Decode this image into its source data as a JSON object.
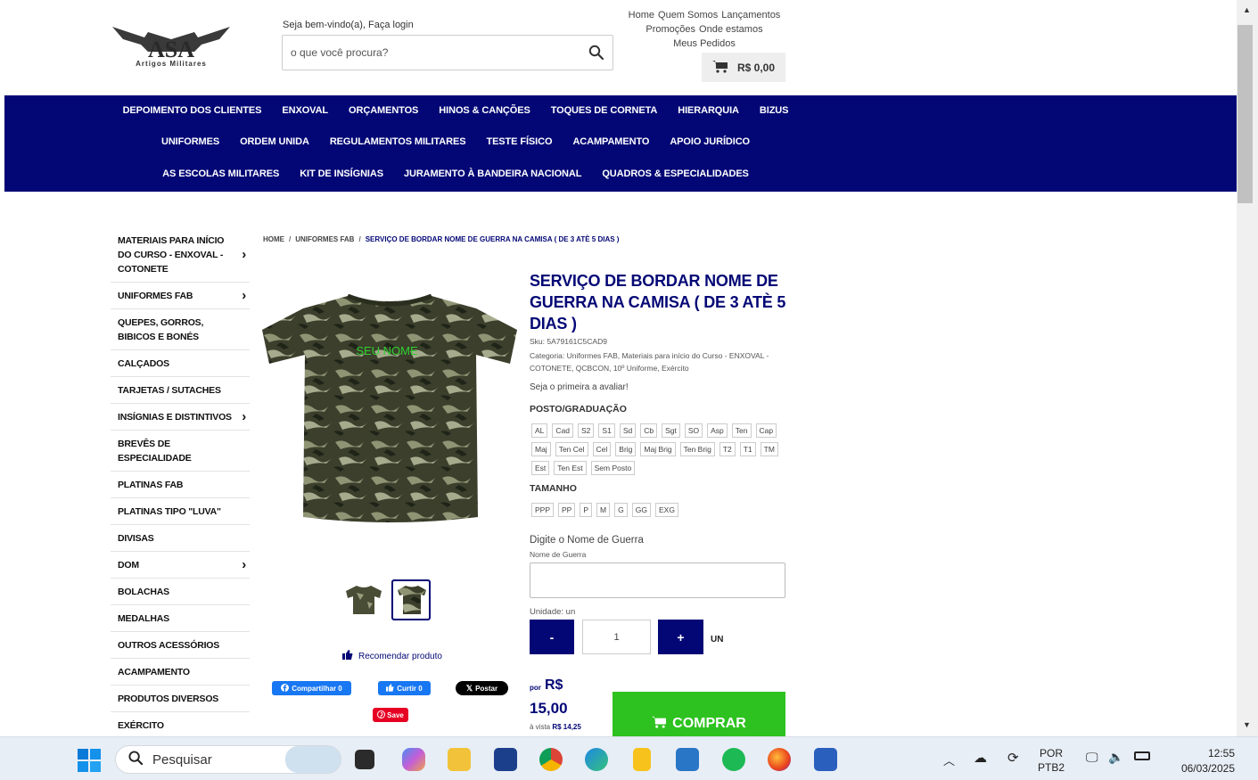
{
  "header": {
    "logo_text": "ASA",
    "logo_sub": "Artigos Militares",
    "welcome": "Seja bem-vindo(a), Faça login",
    "search_placeholder": "o que você procura?",
    "toplinks_row1": [
      "Home",
      "Quem Somos",
      "Lançamentos"
    ],
    "toplinks_row2": [
      "Promoções",
      "Onde estamos"
    ],
    "toplinks_row3": [
      "Meus Pedidos"
    ],
    "cart_total": "R$ 0,00"
  },
  "nav": {
    "row1": [
      "DEPOIMENTO DOS CLIENTES",
      "ENXOVAL",
      "ORÇAMENTOS",
      "HINOS & CANÇÕES",
      "TOQUES DE CORNETA",
      "HIERARQUIA",
      "BIZUS"
    ],
    "row2": [
      "UNIFORMES",
      "ORDEM UNIDA",
      "REGULAMENTOS MILITARES",
      "TESTE FÍSICO",
      "ACAMPAMENTO",
      "APOIO JURÍDICO"
    ],
    "row3": [
      "AS ESCOLAS MILITARES",
      "KIT DE INSÍGNIAS",
      "JURAMENTO À BANDEIRA NACIONAL",
      "QUADROS & ESPECIALIDADES"
    ]
  },
  "sidebar": {
    "items": [
      {
        "label": "MATERIAIS PARA INÍCIO DO CURSO - ENXOVAL - COTONETE",
        "chevron": true
      },
      {
        "label": "UNIFORMES FAB",
        "chevron": true
      },
      {
        "label": "QUEPES, GORROS, BIBICOS E BONÉS",
        "chevron": false
      },
      {
        "label": "CALÇADOS",
        "chevron": false
      },
      {
        "label": "TARJETAS / SUTACHES",
        "chevron": false
      },
      {
        "label": "INSÍGNIAS E DISTINTIVOS",
        "chevron": true
      },
      {
        "label": "BREVÊS DE ESPECIALIDADE",
        "chevron": false
      },
      {
        "label": "PLATINAS FAB",
        "chevron": false
      },
      {
        "label": "PLATINAS TIPO \"LUVA\"",
        "chevron": false
      },
      {
        "label": "DIVISAS",
        "chevron": false
      },
      {
        "label": "DOM",
        "chevron": true
      },
      {
        "label": "BOLACHAS",
        "chevron": false
      },
      {
        "label": "MEDALHAS",
        "chevron": false
      },
      {
        "label": "OUTROS ACESSÓRIOS",
        "chevron": false
      },
      {
        "label": "ACAMPAMENTO",
        "chevron": false
      },
      {
        "label": "PRODUTOS DIVERSOS",
        "chevron": false
      },
      {
        "label": "EXÉRCITO",
        "chevron": false
      }
    ]
  },
  "breadcrumb": {
    "home": "HOME",
    "category": "UNIFORMES FAB",
    "current": "SERVIÇO DE BORDAR NOME DE GUERRA NA CAMISA ( DE 3 ATÈ 5 DIAS )"
  },
  "product": {
    "image_text": "SEU NOME",
    "title": "SERVIÇO DE BORDAR NOME DE GUERRA NA CAMISA ( DE 3 ATÈ 5 DIAS )",
    "sku": "Sku: 5A79161C5CAD9",
    "category": "Categoria: Uniformes FAB,  Materiais para início do Curso - ENXOVAL - COTONETE,  QCBCON,  10º Uniforme,  Exército",
    "review": "Seja o primeira a avaliar!",
    "recommend": "Recomendar produto",
    "posto_label": "POSTO/GRADUAÇÃO",
    "posto_options": [
      "AL",
      "Cad",
      "S2",
      "S1",
      "Sd",
      "Cb",
      "Sgt",
      "SO",
      "Asp",
      "Ten",
      "Cap",
      "Maj",
      "Ten Cel",
      "Cel",
      "Brig",
      "Maj Brig",
      "Ten Brig",
      "T2",
      "T1",
      "TM",
      "Est",
      "Ten Est",
      "Sem Posto"
    ],
    "tamanho_label": "TAMANHO",
    "tamanho_options": [
      "PPP",
      "PP",
      "P",
      "M",
      "G",
      "GG",
      "EXG"
    ],
    "name_label": "Digite o Nome de Guerra",
    "name_sub": "Nome de Guerra",
    "unit_label": "Unidade: un",
    "qty_minus": "-",
    "qty_value": "1",
    "qty_plus": "+",
    "qty_unit": "UN",
    "price_por": "por",
    "price_currency": "R$",
    "price_value": "15,00",
    "price_cash_label": "à vista",
    "price_cash_value": "R$ 14,25",
    "buy_label": "COMPRAR"
  },
  "social": {
    "share": "Compartilhar 0",
    "like": "Curtir 0",
    "post": "Postar",
    "save": "Save"
  },
  "taskbar": {
    "search": "Pesquisar",
    "lang1": "POR",
    "lang2": "PTB2",
    "time": "12:55",
    "date": "06/03/2025"
  },
  "colors": {
    "nav_bg": "#030775",
    "accent": "#030775",
    "buy": "#2ec220"
  }
}
